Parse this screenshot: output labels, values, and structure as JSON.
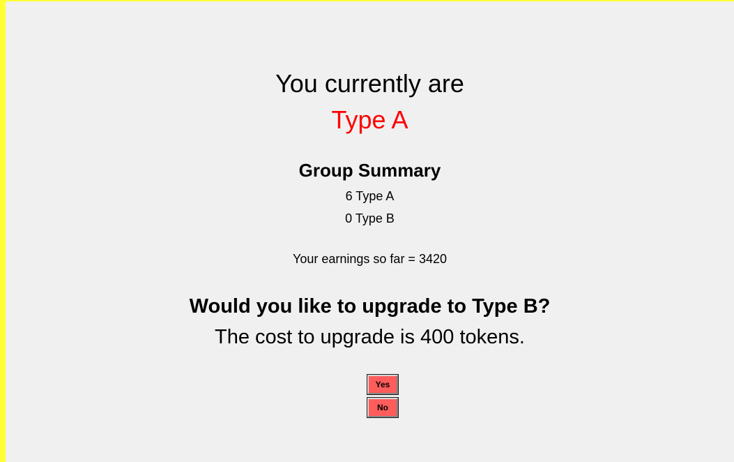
{
  "status": {
    "heading": "You currently are",
    "type_value": "Type A",
    "type_color": "#ff0000"
  },
  "group_summary": {
    "title": "Group Summary",
    "type_a_line": "6 Type A",
    "type_b_line": "0 Type B"
  },
  "earnings": {
    "text": "Your earnings so far = 3420"
  },
  "upgrade": {
    "question": "Would you like to upgrade to Type B?",
    "cost_text": "The cost to upgrade is 400 tokens.",
    "yes_label": "Yes",
    "no_label": "No",
    "button_color": "#ff5c5c"
  },
  "frame": {
    "border_color": "#ffff33",
    "background_color": "#f0f0f0"
  }
}
